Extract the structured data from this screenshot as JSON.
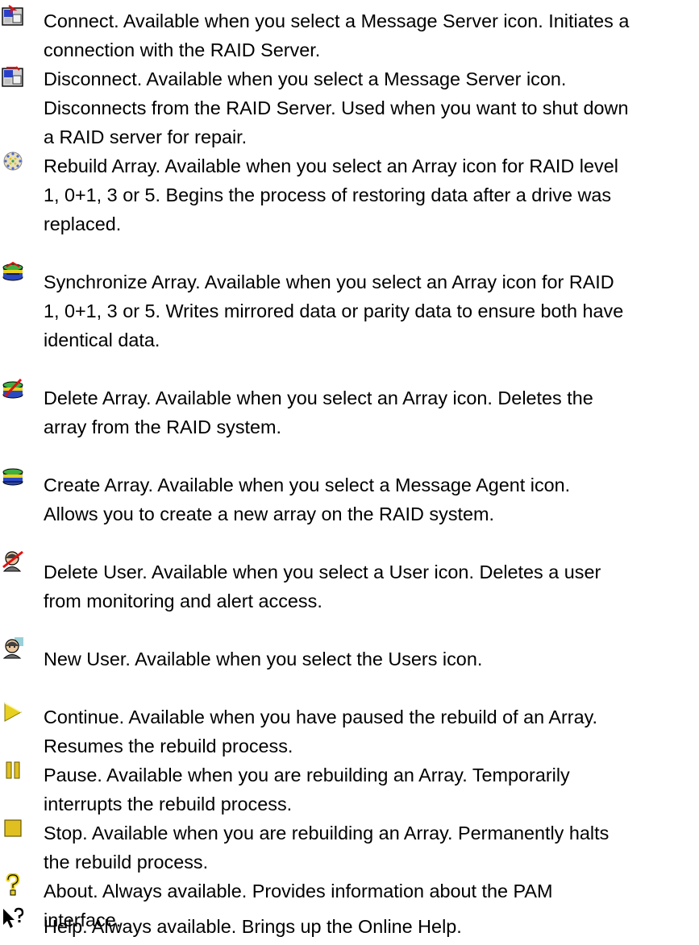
{
  "entries": [
    {
      "icon": "connect-icon",
      "text": "Connect. Available when you select a Message Server icon. Initiates a\nconnection with the RAID Server."
    },
    {
      "icon": "disconnect-icon",
      "text": "Disconnect. Available when you select a Message Server icon.\nDisconnects from the RAID Server. Used when you want to shut down\na RAID server for repair."
    },
    {
      "icon": "rebuild-array-icon",
      "text": "Rebuild Array. Available when you select an Array icon for RAID level\n1, 0+1, 3 or 5. Begins the process of restoring data after a drive was\nreplaced."
    },
    {
      "icon": "synchronize-array-icon",
      "text": "Synchronize Array. Available when you select an Array icon for RAID\n1, 0+1, 3 or 5. Writes mirrored data or parity data to ensure both have\nidentical data."
    },
    {
      "icon": "delete-array-icon",
      "text": "Delete Array. Available when you select an Array icon. Deletes the\narray from the RAID system."
    },
    {
      "icon": "create-array-icon",
      "text": "Create Array. Available when you select a Message Agent icon.\nAllows you to create a new array on the RAID system."
    },
    {
      "icon": "delete-user-icon",
      "text": "Delete User. Available when you select a User icon. Deletes a user\nfrom monitoring and alert access."
    },
    {
      "icon": "new-user-icon",
      "text": "New User. Available when you select the Users icon."
    },
    {
      "icon": "continue-icon",
      "text": "Continue. Available when you have paused the rebuild of an Array.\nResumes the rebuild process."
    },
    {
      "icon": "pause-icon",
      "text": "Pause. Available when you are rebuilding an Array. Temporarily\ninterrupts the rebuild process."
    },
    {
      "icon": "stop-icon",
      "text": "Stop. Available when you are rebuilding an Array. Permanently halts\nthe rebuild process."
    },
    {
      "icon": "about-icon",
      "text": "About. Always available. Provides information about the PAM\ninterface."
    },
    {
      "icon": "help-icon",
      "text": "Help. Always available. Brings up the Online Help."
    }
  ]
}
